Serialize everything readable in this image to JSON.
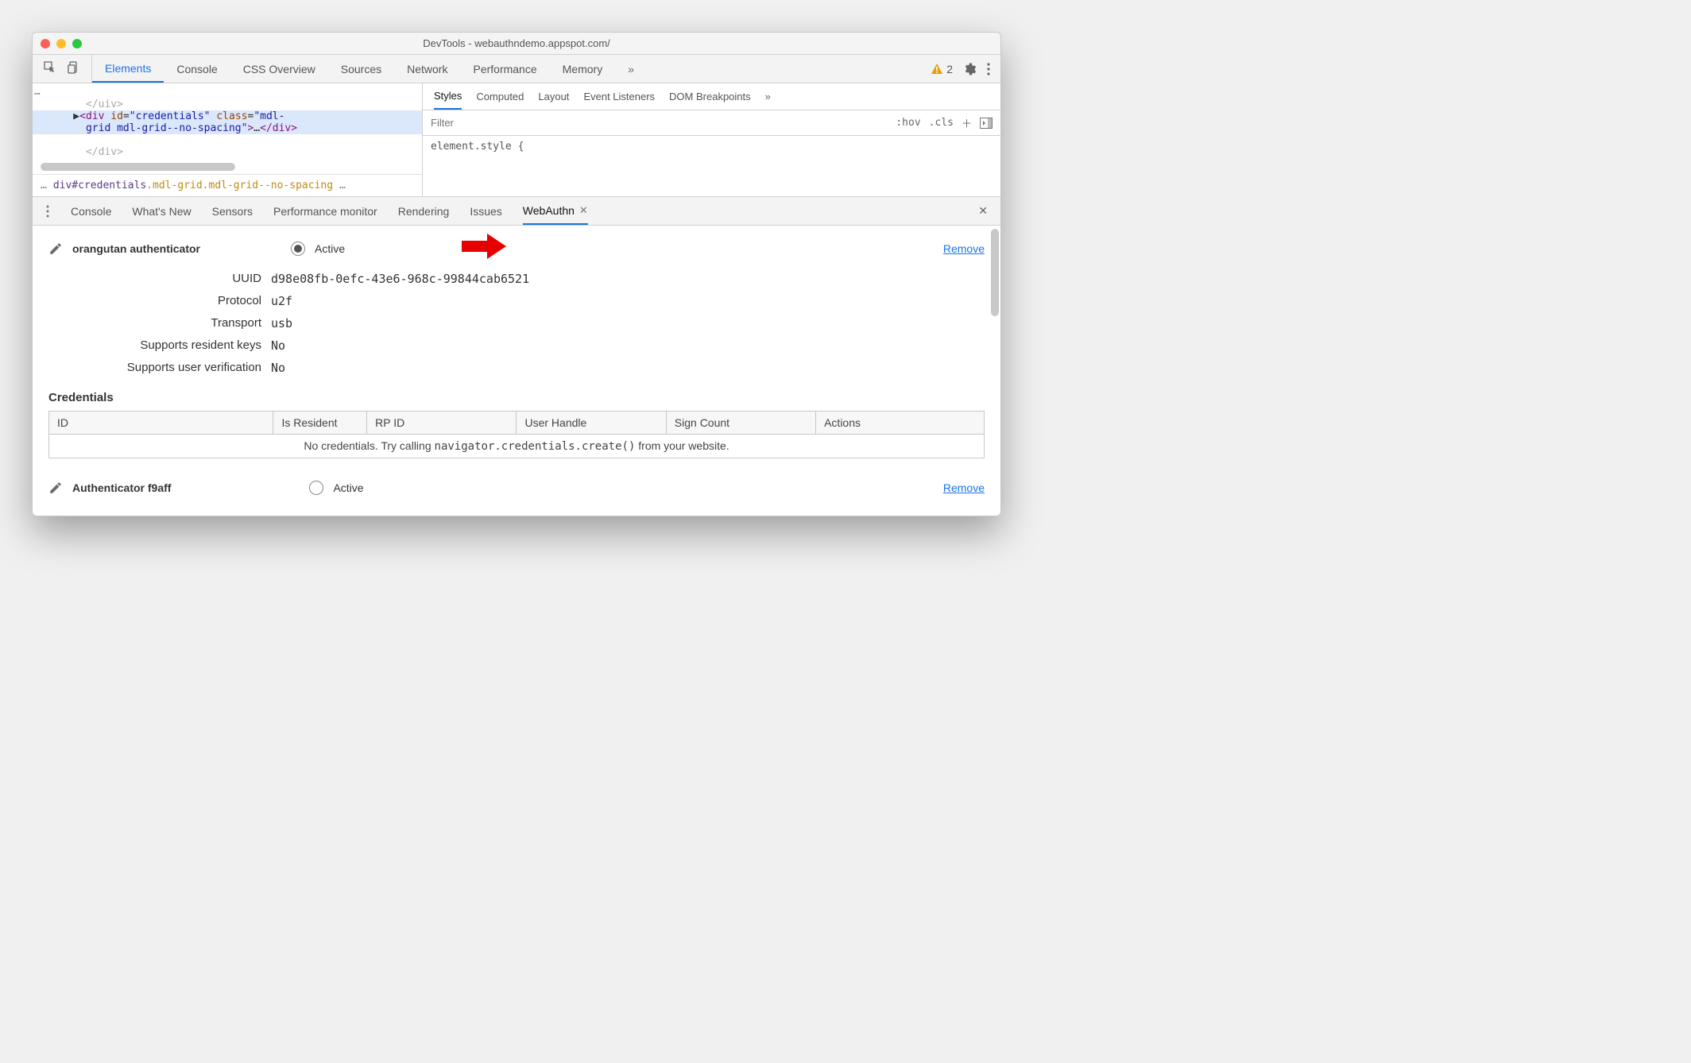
{
  "window": {
    "title": "DevTools - webauthndemo.appspot.com/"
  },
  "main_tabs": [
    "Elements",
    "Console",
    "CSS Overview",
    "Sources",
    "Network",
    "Performance",
    "Memory"
  ],
  "main_tabs_more_glyph": "»",
  "warning_count": "2",
  "dom": {
    "line0": "</uiv>",
    "sel_open": "<div id=\"credentials\" class=\"mdl-",
    "sel_cont": "grid mdl-grid--no-spacing\">…</div>",
    "bc_prefix": "div#credentials",
    "bc_classes": ".mdl-grid.mdl-grid--no-spacing"
  },
  "styles": {
    "tabs": [
      "Styles",
      "Computed",
      "Layout",
      "Event Listeners",
      "DOM Breakpoints"
    ],
    "more_glyph": "»",
    "filter_ph": "Filter",
    "hov": ":hov",
    "cls": ".cls",
    "body": "element.style {"
  },
  "drawer_tabs": [
    "Console",
    "What's New",
    "Sensors",
    "Performance monitor",
    "Rendering",
    "Issues",
    "WebAuthn"
  ],
  "auth1": {
    "name": "orangutan authenticator",
    "active_label": "Active",
    "remove": "Remove",
    "fields": {
      "uuid_l": "UUID",
      "uuid": "d98e08fb-0efc-43e6-968c-99844cab6521",
      "proto_l": "Protocol",
      "proto": "u2f",
      "trans_l": "Transport",
      "trans": "usb",
      "srk_l": "Supports resident keys",
      "srk": "No",
      "suv_l": "Supports user verification",
      "suv": "No"
    }
  },
  "credentials": {
    "heading": "Credentials",
    "cols": [
      "ID",
      "Is Resident",
      "RP ID",
      "User Handle",
      "Sign Count",
      "Actions"
    ],
    "empty_pre": "No credentials. Try calling ",
    "empty_code": "navigator.credentials.create()",
    "empty_post": " from your website."
  },
  "auth2": {
    "name": "Authenticator f9aff",
    "active_label": "Active",
    "remove": "Remove"
  }
}
